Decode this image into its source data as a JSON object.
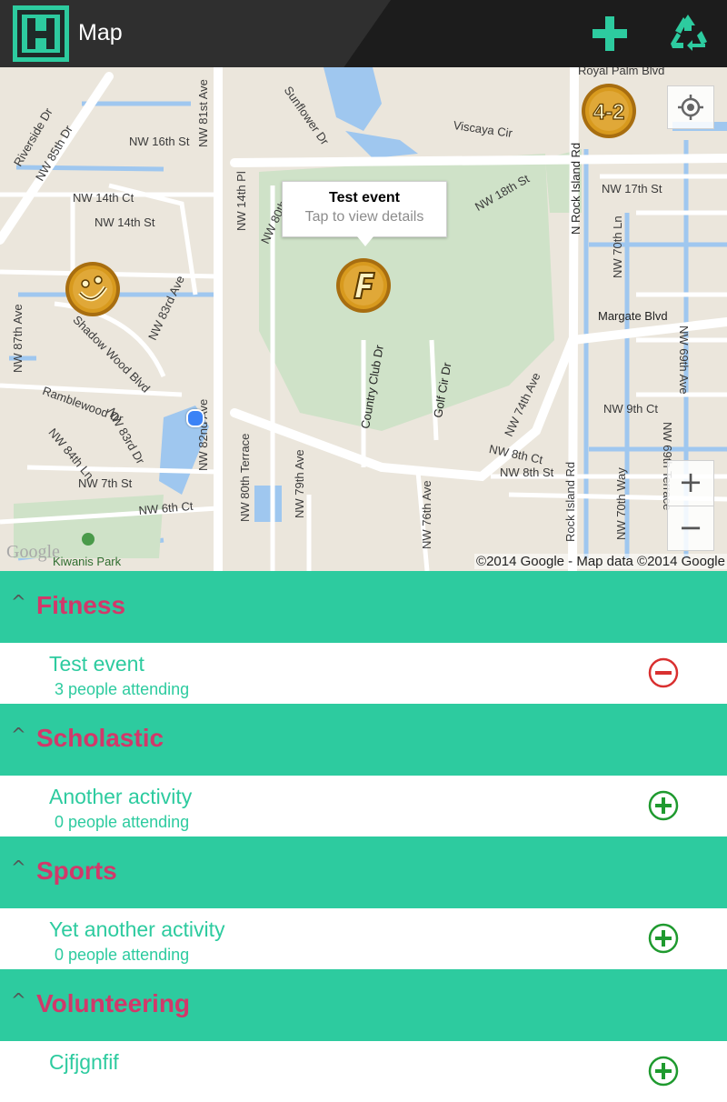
{
  "app": {
    "title": "Map"
  },
  "toolbar": {
    "add_icon": "plus-icon",
    "recycle_icon": "recycle-icon"
  },
  "map": {
    "streets": [
      "Royal Palm Blvd",
      "Viscaya Cir",
      "Sunflower Dr",
      "NW 16th St",
      "NW 81st Ave",
      "Riverside Dr",
      "NW 85th Dr",
      "NW 14th Ct",
      "NW 14th St",
      "NW 14th Pl",
      "NW 80th",
      "NW 18th St",
      "N Rock Island Rd",
      "NW 17th St",
      "NW 70th Ln",
      "NW 69th Ave",
      "Margate Blvd",
      "NW 83rd Ave",
      "Shadow Wood Blvd",
      "NW 87th Ave",
      "Ramblewood Dr",
      "NW 83rd Dr",
      "NW 84th Ln",
      "NW 82nd Ave",
      "Country Club Dr",
      "Golf Cir Dr",
      "NW 74th Ave",
      "NW 9th Ct",
      "NW 8th Ct",
      "NW 8th St",
      "NW 69th Terrace",
      "NW 7th St",
      "NW 6th Ct",
      "NW 80th Terrace",
      "NW 79th Ave",
      "NW 76th Ave",
      "Rock Island Rd",
      "NW 70th Way"
    ],
    "park_label": "Kiwanis Park",
    "watermark": "Google",
    "copyright": "©2014 Google - Map data ©2014 Google",
    "infowindow": {
      "title": "Test event",
      "subtitle": "Tap to view details"
    },
    "markers": [
      "letter-f-coin-marker",
      "smiley-coin-marker",
      "four-two-coin-marker"
    ],
    "zoom_in": "+",
    "zoom_out": "−",
    "colors": {
      "land": "#ebe6dc",
      "road": "#ffffff",
      "water": "#9fc7ef",
      "park": "#cfe2c8",
      "marker_gold": "#d89a1e"
    }
  },
  "categories": [
    {
      "name": "Fitness",
      "chevron": "^",
      "items": [
        {
          "name": "Test event",
          "count": "3 people attending",
          "action": "remove-icon"
        }
      ]
    },
    {
      "name": "Scholastic",
      "chevron": "^",
      "items": [
        {
          "name": "Another activity",
          "count": "0 people attending",
          "action": "add-icon"
        }
      ]
    },
    {
      "name": "Sports",
      "chevron": "^",
      "items": [
        {
          "name": "Yet another activity",
          "count": "0 people attending",
          "action": "add-icon"
        }
      ]
    },
    {
      "name": "Volunteering",
      "chevron": "^",
      "items": [
        {
          "name": "Cjfjgnfif",
          "count": "",
          "action": "add-icon"
        }
      ]
    }
  ],
  "colors": {
    "accent": "#2dcb9f",
    "category_text": "#d2386a",
    "remove": "#d93030",
    "add": "#1f9a2f"
  }
}
